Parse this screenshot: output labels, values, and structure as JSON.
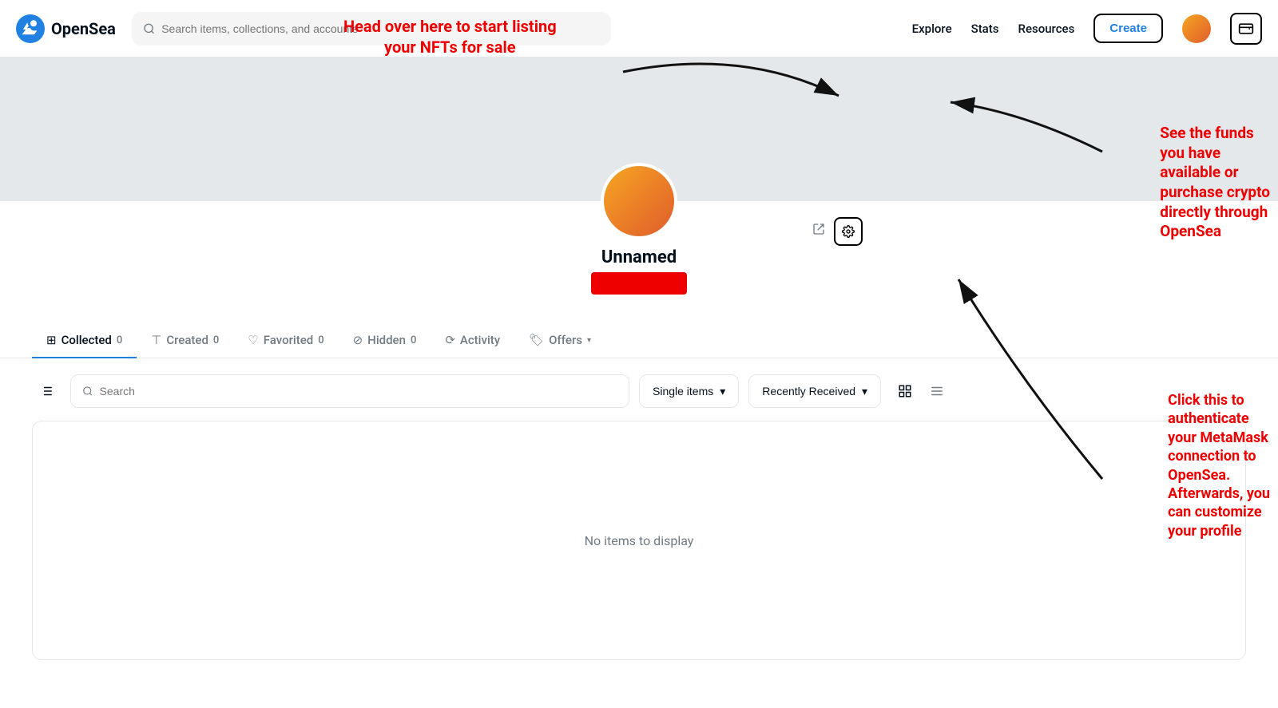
{
  "brand": {
    "name": "OpenSea",
    "logo_color": "#2081e2"
  },
  "navbar": {
    "search_placeholder": "Search items, collections, and accounts",
    "nav_items": [
      "Explore",
      "Stats",
      "Resources"
    ],
    "create_label": "Create"
  },
  "profile": {
    "name": "Unnamed",
    "settings_icon": "⚙",
    "share_icon": "<"
  },
  "tabs": [
    {
      "id": "collected",
      "label": "Collected",
      "count": "0",
      "icon": "🗂",
      "active": true
    },
    {
      "id": "created",
      "label": "Created",
      "count": "0",
      "icon": "🏷"
    },
    {
      "id": "favorited",
      "label": "Favorited",
      "count": "0",
      "icon": "♡"
    },
    {
      "id": "hidden",
      "label": "Hidden",
      "count": "0",
      "icon": "🙈"
    },
    {
      "id": "activity",
      "label": "Activity",
      "icon": "⟳"
    },
    {
      "id": "offers",
      "label": "Offers",
      "icon": "🏷",
      "has_chevron": true
    }
  ],
  "toolbar": {
    "search_placeholder": "Search",
    "dropdown_single_items": "Single items",
    "dropdown_recently_received": "Recently Received"
  },
  "empty_message": "No items to display",
  "annotations": {
    "arrow1_text": "Head over here to start listing\nyour NFTs for sale",
    "arrow2_text": "See the funds\nyou have\navailable or\npurchase crypto\ndirectly through\nOpenSea",
    "arrow3_text": "Click this to\nauthenticate\nyour MetaMask\nconnection to\nOpenSea.\nAfterwards, you\ncan customize\nyour profile"
  }
}
